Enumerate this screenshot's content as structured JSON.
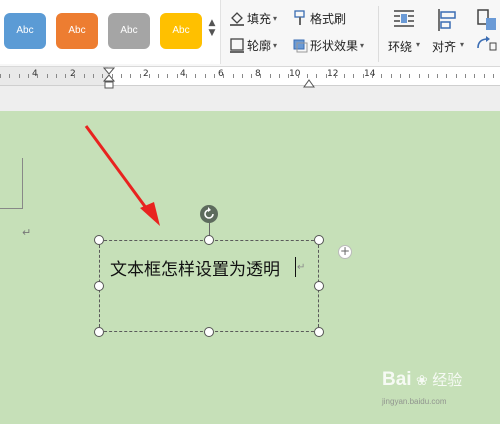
{
  "ribbon": {
    "shape_styles": [
      "Abc",
      "Abc",
      "Abc",
      "Abc"
    ],
    "style_colors": [
      "#5b9bd5",
      "#ed7d31",
      "#a5a5a5",
      "#ffc000"
    ],
    "fill_label": "填充",
    "outline_label": "轮廓",
    "format_painter_label": "格式刷",
    "shape_effects_label": "形状效果",
    "wrap_label": "环绕",
    "align_label": "对齐"
  },
  "ruler": {
    "labels": [
      "4",
      "2",
      "2",
      "4",
      "6",
      "8",
      "10",
      "12",
      "14"
    ]
  },
  "document": {
    "textbox_text": "文本框怎样设置为透明",
    "paragraph_mark": "↵"
  },
  "annotation": {
    "arrow_color": "#e8231f"
  },
  "watermark": {
    "brand_text": "Bai",
    "brand_suffix": "经验",
    "url_text": "jingyan.baidu.com"
  }
}
